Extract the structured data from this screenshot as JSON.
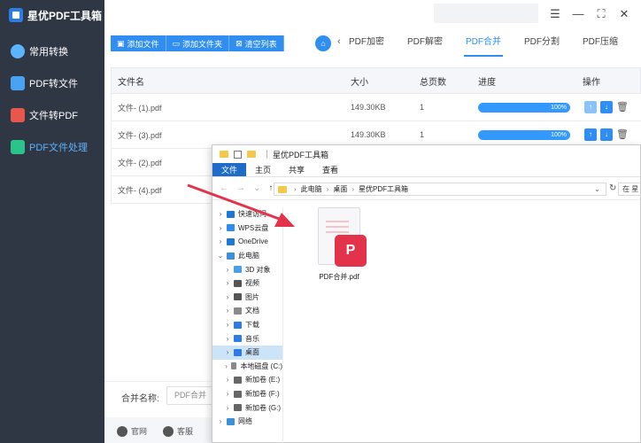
{
  "app": {
    "title": "星优PDF工具箱"
  },
  "sidebar": {
    "items": [
      {
        "label": "常用转换",
        "icon": "convert-icon"
      },
      {
        "label": "PDF转文件",
        "icon": "pdf-to-file-icon"
      },
      {
        "label": "文件转PDF",
        "icon": "file-to-pdf-icon"
      },
      {
        "label": "PDF文件处理",
        "icon": "pdf-process-icon",
        "active": true
      }
    ]
  },
  "toolbar": {
    "add_file": "添加文件",
    "add_folder": "添加文件夹",
    "clear_list": "清空列表"
  },
  "tabs": [
    {
      "label": "PDF加密"
    },
    {
      "label": "PDF解密"
    },
    {
      "label": "PDF合并",
      "active": true
    },
    {
      "label": "PDF分割"
    },
    {
      "label": "PDF压缩"
    }
  ],
  "table": {
    "headers": {
      "name": "文件名",
      "size": "大小",
      "pages": "总页数",
      "progress": "进度",
      "action": "操作"
    },
    "rows": [
      {
        "name": "文件- (1).pdf",
        "size": "149.30KB",
        "pages": "1",
        "progress": "100%"
      },
      {
        "name": "文件- (3).pdf",
        "size": "149.30KB",
        "pages": "1",
        "progress": "100%"
      },
      {
        "name": "文件- (2).pdf",
        "size": "",
        "pages": "",
        "progress": ""
      },
      {
        "name": "文件- (4).pdf",
        "size": "",
        "pages": "",
        "progress": ""
      }
    ]
  },
  "bottom": {
    "merge_label": "合并名称:",
    "merge_value": "PDF合并",
    "link_official": "官网",
    "link_support": "客服"
  },
  "explorer": {
    "title": "星优PDF工具箱",
    "ribbon": [
      "文件",
      "主页",
      "共享",
      "查看"
    ],
    "breadcrumb": [
      "此电脑",
      "桌面",
      "星优PDF工具箱"
    ],
    "search_placeholder": "在 星",
    "tree": [
      {
        "label": "快速访问",
        "level": 0,
        "icon_color": "#1e78d6"
      },
      {
        "label": "WPS云盘",
        "level": 0,
        "icon_color": "#2d8cf0"
      },
      {
        "label": "OneDrive",
        "level": 0,
        "icon_color": "#1e78d6"
      },
      {
        "label": "此电脑",
        "level": 0,
        "icon_color": "#3d8fd8",
        "expanded": true
      },
      {
        "label": "3D 对象",
        "level": 1,
        "icon_color": "#44a0e8"
      },
      {
        "label": "视频",
        "level": 1,
        "icon_color": "#555555"
      },
      {
        "label": "图片",
        "level": 1,
        "icon_color": "#555555"
      },
      {
        "label": "文档",
        "level": 1,
        "icon_color": "#8a8a8a"
      },
      {
        "label": "下载",
        "level": 1,
        "icon_color": "#2d7be5"
      },
      {
        "label": "音乐",
        "level": 1,
        "icon_color": "#2d7be5"
      },
      {
        "label": "桌面",
        "level": 1,
        "icon_color": "#2d7be5",
        "selected": true
      },
      {
        "label": "本地磁盘 (C:)",
        "level": 1,
        "icon_color": "#8a8a8a"
      },
      {
        "label": "新加卷 (E:)",
        "level": 1,
        "icon_color": "#666666"
      },
      {
        "label": "新加卷 (F:)",
        "level": 1,
        "icon_color": "#666666"
      },
      {
        "label": "新加卷 (G:)",
        "level": 1,
        "icon_color": "#666666"
      },
      {
        "label": "网络",
        "level": 0,
        "icon_color": "#3d8fd8"
      }
    ],
    "file": {
      "name": "PDF合并.pdf",
      "badge": "P"
    }
  },
  "colors": {
    "accent": "#2f8ef0",
    "sidebar_bg": "#2f3644",
    "pdf_red": "#e2334b",
    "arrow": "#e2334b"
  }
}
